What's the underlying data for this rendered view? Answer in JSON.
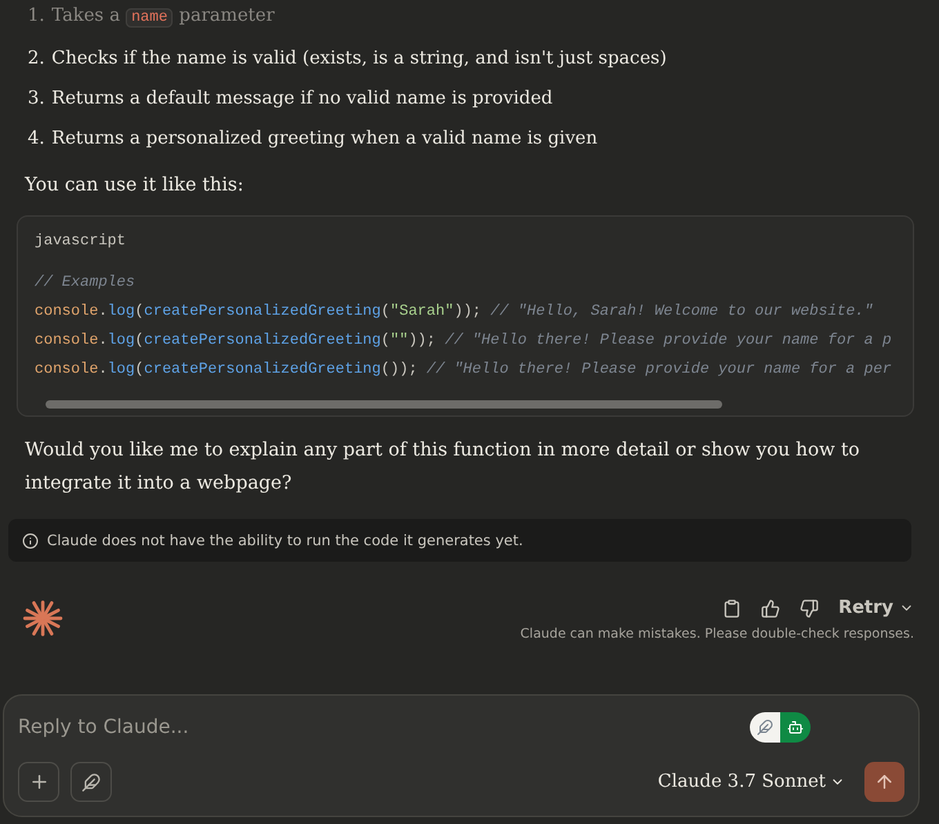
{
  "steps": [
    {
      "number": "1.",
      "parts": [
        {
          "kind": "text",
          "text": "Takes a "
        },
        {
          "kind": "code",
          "text": "name"
        },
        {
          "kind": "text",
          "text": " parameter"
        }
      ],
      "faded": true
    },
    {
      "number": "2.",
      "parts": [
        {
          "kind": "text",
          "text": "Checks if the name is valid (exists, is a string, and isn't just spaces)"
        }
      ],
      "faded": false
    },
    {
      "number": "3.",
      "parts": [
        {
          "kind": "text",
          "text": "Returns a default message if no valid name is provided"
        }
      ],
      "faded": false
    },
    {
      "number": "4.",
      "parts": [
        {
          "kind": "text",
          "text": "Returns a personalized greeting when a valid name is given"
        }
      ],
      "faded": false
    }
  ],
  "intro": "You can use it like this:",
  "code_block": {
    "language": "javascript",
    "lines": [
      [
        {
          "kind": "comment",
          "text": "// Examples"
        }
      ],
      [
        {
          "kind": "object",
          "text": "console"
        },
        {
          "kind": "punct",
          "text": "."
        },
        {
          "kind": "fn",
          "text": "log"
        },
        {
          "kind": "punct",
          "text": "("
        },
        {
          "kind": "fn",
          "text": "createPersonalizedGreeting"
        },
        {
          "kind": "punct",
          "text": "("
        },
        {
          "kind": "string",
          "text": "\"Sarah\""
        },
        {
          "kind": "punct",
          "text": ")); "
        },
        {
          "kind": "comment",
          "text": "// \"Hello, Sarah! Welcome to our website.\""
        }
      ],
      [
        {
          "kind": "object",
          "text": "console"
        },
        {
          "kind": "punct",
          "text": "."
        },
        {
          "kind": "fn",
          "text": "log"
        },
        {
          "kind": "punct",
          "text": "("
        },
        {
          "kind": "fn",
          "text": "createPersonalizedGreeting"
        },
        {
          "kind": "punct",
          "text": "("
        },
        {
          "kind": "string",
          "text": "\"\""
        },
        {
          "kind": "punct",
          "text": ")); "
        },
        {
          "kind": "comment",
          "text": "// \"Hello there! Please provide your name for a p"
        }
      ],
      [
        {
          "kind": "object",
          "text": "console"
        },
        {
          "kind": "punct",
          "text": "."
        },
        {
          "kind": "fn",
          "text": "log"
        },
        {
          "kind": "punct",
          "text": "("
        },
        {
          "kind": "fn",
          "text": "createPersonalizedGreeting"
        },
        {
          "kind": "punct",
          "text": "()); "
        },
        {
          "kind": "comment",
          "text": "// \"Hello there! Please provide your name for a per"
        }
      ]
    ]
  },
  "question": "Would you like me to explain any part of this function in more detail or show you how to integrate it into a webpage?",
  "notice": "Claude does not have the ability to run the code it generates yet.",
  "actions": {
    "retry": "Retry",
    "disclaimer": "Claude can make mistakes. Please double-check responses."
  },
  "composer": {
    "placeholder": "Reply to Claude...",
    "model": "Claude 3.7 Sonnet"
  }
}
